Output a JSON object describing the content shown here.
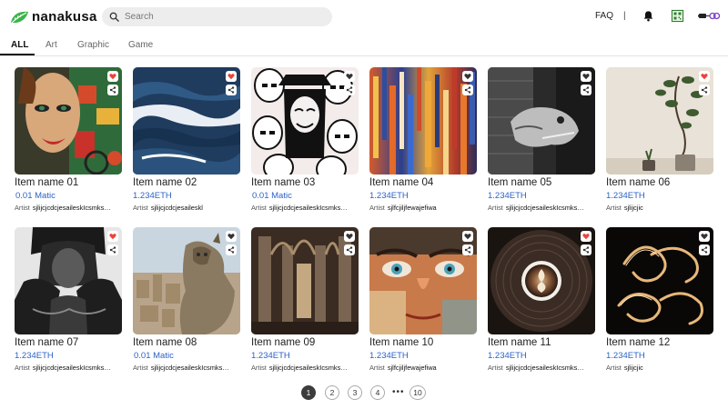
{
  "app": {
    "name": "nanakusa"
  },
  "header": {
    "search_placeholder": "Search",
    "faq_label": "FAQ",
    "separator": "|",
    "icons": [
      "bell-icon",
      "qr-code-icon",
      "wallet-link-icon"
    ]
  },
  "tabs": [
    {
      "label": "ALL",
      "active": true
    },
    {
      "label": "Art",
      "active": false
    },
    {
      "label": "Graphic",
      "active": false
    },
    {
      "label": "Game",
      "active": false
    }
  ],
  "items": [
    {
      "name": "Item name 01",
      "price": "0.01 Matic",
      "artist_label": "Artist",
      "artist": "sjlijcjcdcjesaileskIcsmks…",
      "liked": true
    },
    {
      "name": "Item name 02",
      "price": "1.234ETH",
      "artist_label": "Artist",
      "artist": "sjlijcjcdcjesaileskl",
      "liked": true
    },
    {
      "name": "Item name 03",
      "price": "0.01 Matic",
      "artist_label": "Artist",
      "artist": "sjlijcjcdcjesaileskIcsmks…",
      "liked": false
    },
    {
      "name": "Item name 04",
      "price": "1.234ETH",
      "artist_label": "Artist",
      "artist": "sjlfcjiljfewajefiwa",
      "liked": false
    },
    {
      "name": "Item name 05",
      "price": "1.234ETH",
      "artist_label": "Artist",
      "artist": "sjlijcjcdcjesaileskIcsmks…",
      "liked": false
    },
    {
      "name": "Item name 06",
      "price": "1.234ETH",
      "artist_label": "Artist",
      "artist": "sjlijcjic",
      "liked": true
    },
    {
      "name": "Item name 07",
      "price": "1.234ETH",
      "artist_label": "Artist",
      "artist": "sjlijcjcdcjesaileskIcsmks…",
      "liked": true
    },
    {
      "name": "Item name 08",
      "price": "0.01 Matic",
      "artist_label": "Artist",
      "artist": "sjlijcjcdcjesaileskIcsmks…",
      "liked": false
    },
    {
      "name": "Item name 09",
      "price": "1.234ETH",
      "artist_label": "Artist",
      "artist": "sjlijcjcdcjesaileskIcsmks…",
      "liked": false
    },
    {
      "name": "Item name 10",
      "price": "1.234ETH",
      "artist_label": "Artist",
      "artist": "sjlfcjiljfewajefiwa",
      "liked": false
    },
    {
      "name": "Item name 11",
      "price": "1.234ETH",
      "artist_label": "Artist",
      "artist": "sjlijcjcdcjesaileskIcsmks…",
      "liked": true
    },
    {
      "name": "Item name 12",
      "price": "1.234ETH",
      "artist_label": "Artist",
      "artist": "sjlijcjic",
      "liked": false
    }
  ],
  "pagination": {
    "pages": [
      "1",
      "2",
      "3",
      "4"
    ],
    "ellipsis": "•••",
    "last": "10",
    "current": "1"
  },
  "colors": {
    "price": "#2b62c7",
    "like_active": "#e8453c",
    "brand_leaf": "#3cb44a"
  }
}
